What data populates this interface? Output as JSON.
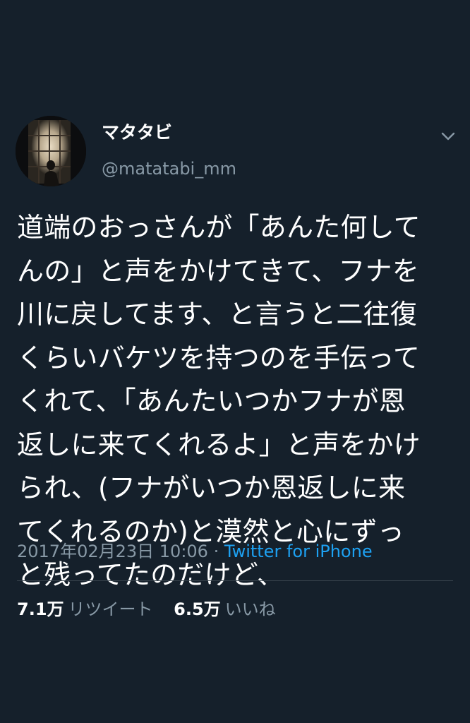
{
  "tweet": {
    "display_name": "マタタビ",
    "handle": "@matatabi_mm",
    "menu_icon": "chevron-down-icon",
    "avatar_icon": "silhouette-window-avatar",
    "text_lines": [
      "道端のおっさんが「あんた何して",
      "んの」と声をかけてきて、フナを",
      "川に戻してます、と言うと二往復",
      "くらいバケツを持つのを手伝って",
      "くれて、「あんたいつかフナが恩",
      "返しに来てくれるよ」と声をかけ",
      "られ、(フナがいつか恩返しに来",
      "てくれるのか)と漠然と心にずっ",
      "と残ってたのだけど、"
    ],
    "timestamp": "2017年02月23日 10:06",
    "separator": "·",
    "source": "Twitter for iPhone",
    "retweets": {
      "count": "7.1万",
      "label": "リツイート"
    },
    "likes": {
      "count": "6.5万",
      "label": "いいね"
    }
  },
  "colors": {
    "background": "#15202b",
    "text": "#ffffff",
    "secondary": "#8899a6",
    "link": "#1da1f2",
    "divider": "#38444d"
  }
}
